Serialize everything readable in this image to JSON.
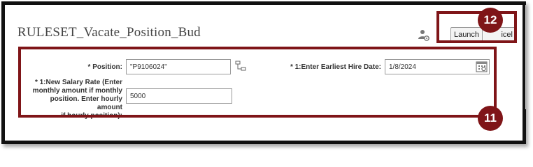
{
  "page": {
    "title": "RULESET_Vacate_Position_Bud"
  },
  "toolbar": {
    "launch_label": "Launch",
    "cancel_label": "icel"
  },
  "form": {
    "position_label": "* Position:",
    "position_value": "\"P9106024\"",
    "hire_date_label": "* 1:Enter Earliest Hire Date:",
    "hire_date_value": "1/8/2024",
    "salary_label_lines": [
      "* 1:New Salary Rate (Enter",
      "monthly amount if monthly",
      "position. Enter hourly amount",
      "if hourly position):"
    ],
    "salary_value": "5000"
  },
  "callouts": {
    "form_number": "11",
    "launch_number": "12"
  },
  "icons": {
    "user_settings": "user-gear-icon",
    "hierarchy": "hierarchy-icon",
    "calendar": "calendar-icon"
  },
  "colors": {
    "callout": "#7f1518",
    "frame": "#111111"
  }
}
